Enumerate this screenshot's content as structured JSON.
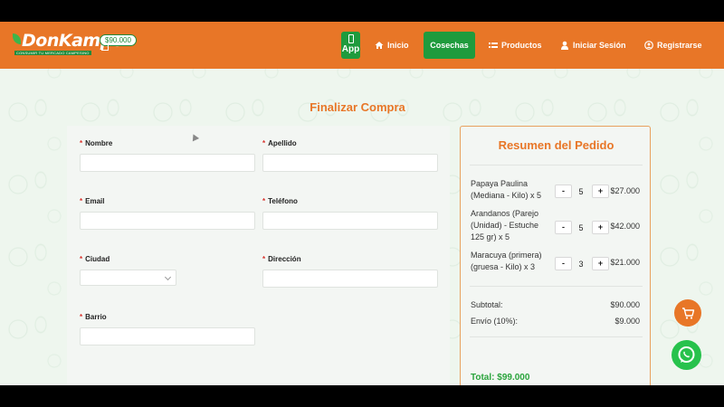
{
  "header": {
    "logo": "DonKampo",
    "slogan": "CONSUMIR TU MERCADO CAMPESINO",
    "cart_amount": "$90.000",
    "app_label": "App",
    "nav": [
      {
        "label": "Inicio",
        "icon": "home-icon"
      },
      {
        "label": "Cosechas",
        "icon": ""
      },
      {
        "label": "Productos",
        "icon": "list-icon"
      },
      {
        "label": "Iniciar Sesión",
        "icon": "user-icon"
      },
      {
        "label": "Registrarse",
        "icon": "user-circle-icon"
      }
    ]
  },
  "page": {
    "title": "Finalizar Compra"
  },
  "form": {
    "required_mark": "*",
    "fields": [
      {
        "label": "Nombre",
        "value": ""
      },
      {
        "label": "Apellido",
        "value": ""
      },
      {
        "label": "Email",
        "value": ""
      },
      {
        "label": "Teléfono",
        "value": ""
      },
      {
        "label": "Ciudad",
        "value": ""
      },
      {
        "label": "Dirección",
        "value": ""
      },
      {
        "label": "Barrio",
        "value": ""
      }
    ]
  },
  "summary": {
    "title": "Resumen del Pedido",
    "items": [
      {
        "name": "Papaya Paulina (Mediana - Kilo) x 5",
        "qty": "5",
        "price": "$27.000"
      },
      {
        "name": "Arandanos (Parejo (Unidad) - Estuche 125 gr) x 5",
        "qty": "5",
        "price": "$42.000"
      },
      {
        "name": "Maracuya (primera) (gruesa - Kilo) x 3",
        "qty": "3",
        "price": "$21.000"
      }
    ],
    "minus": "-",
    "plus": "+",
    "subtotal_label": "Subtotal:",
    "subtotal_value": "$90.000",
    "shipping_label": "Envío (10%):",
    "shipping_value": "$9.000",
    "total_label": "Total: $99.000"
  },
  "colors": {
    "brand_orange": "#e87627",
    "brand_green": "#1f9b3d",
    "total_green": "#2aa43c",
    "required_red": "#d9332d",
    "whatsapp_green": "#27c24c"
  }
}
